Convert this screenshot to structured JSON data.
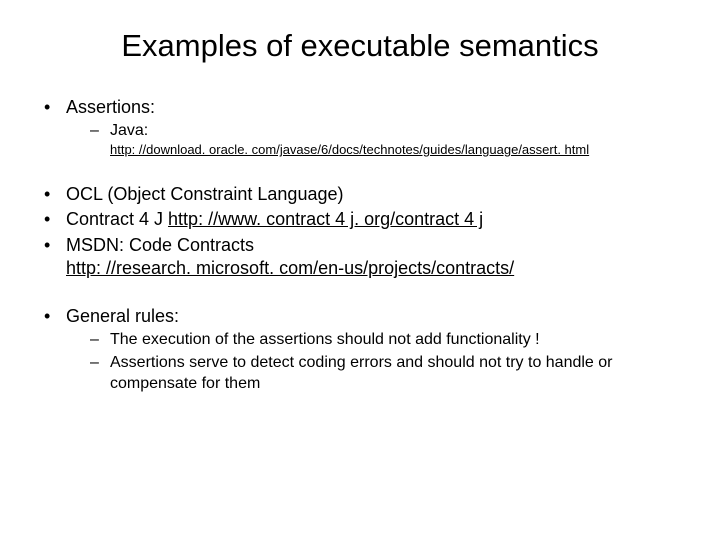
{
  "title": "Examples of executable semantics",
  "g1": {
    "assertions": "Assertions:",
    "java": "Java:",
    "java_link": "http: //download. oracle. com/javase/6/docs/technotes/guides/language/assert. html"
  },
  "g2": {
    "ocl": "OCL (Object Constraint Language)",
    "contract_prefix": "Contract 4 J ",
    "contract_link": "http: //www. contract 4 j. org/contract 4 j",
    "msdn": "MSDN: Code Contracts",
    "msdn_link": "http: //research. microsoft. com/en-us/projects/contracts/"
  },
  "g3": {
    "heading": "General rules:",
    "r1": "The execution of the assertions should not add functionality !",
    "r2": "Assertions serve to detect coding errors and should not try to handle or compensate for them"
  }
}
